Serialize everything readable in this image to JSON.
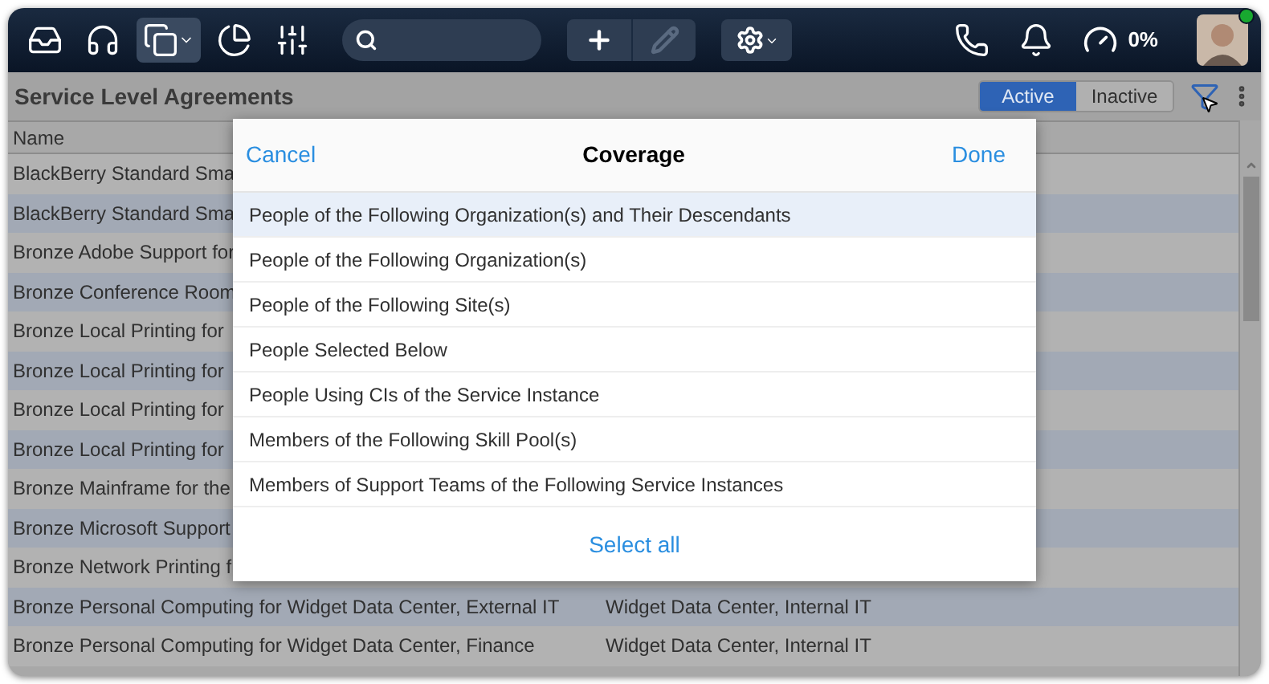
{
  "top_bar": {
    "nav": [
      {
        "selected": false
      },
      {
        "selected": false
      },
      {
        "selected": true
      },
      {
        "selected": false
      },
      {
        "selected": false
      }
    ],
    "actions": [
      {
        "kind": "add",
        "disabled": false
      },
      {
        "kind": "edit",
        "disabled": true
      }
    ],
    "progress": "0%"
  },
  "header": {
    "title": "Service Level Agreements",
    "segments": [
      {
        "label": "Active",
        "selected": true
      },
      {
        "label": "Inactive",
        "selected": false
      }
    ]
  },
  "table": {
    "columns": [
      "Name"
    ],
    "rows": [
      {
        "name": "BlackBerry Standard Sma"
      },
      {
        "name": "BlackBerry Standard Sma"
      },
      {
        "name": "Bronze Adobe Support for"
      },
      {
        "name": "Bronze Conference Room"
      },
      {
        "name": "Bronze Local Printing for"
      },
      {
        "name": "Bronze Local Printing for"
      },
      {
        "name": "Bronze Local Printing for"
      },
      {
        "name": "Bronze Local Printing for"
      },
      {
        "name": "Bronze Mainframe for the"
      },
      {
        "name": "Bronze Microsoft Support"
      },
      {
        "name": "Bronze Network Printing f"
      },
      {
        "name": "Bronze Personal Computing for Widget Data Center, External IT",
        "column_2": "Widget Data Center, Internal IT"
      },
      {
        "name": "Bronze Personal Computing for Widget Data Center, Finance",
        "column_2": "Widget Data Center, Internal IT"
      }
    ]
  },
  "popup": {
    "cancel": "Cancel",
    "title": "Coverage",
    "done": "Done",
    "options": [
      {
        "label": "People of the Following Organization(s) and Their Descendants",
        "selected": true
      },
      {
        "label": "People of the Following Organization(s)",
        "selected": false
      },
      {
        "label": "People of the Following Site(s)",
        "selected": false
      },
      {
        "label": "People Selected Below",
        "selected": false
      },
      {
        "label": "People Using CIs of the Service Instance",
        "selected": false
      },
      {
        "label": "Members of the Following Skill Pool(s)",
        "selected": false
      },
      {
        "label": "Members of Support Teams of the Following Service Instances",
        "selected": false
      }
    ],
    "select_all": "Select all"
  }
}
